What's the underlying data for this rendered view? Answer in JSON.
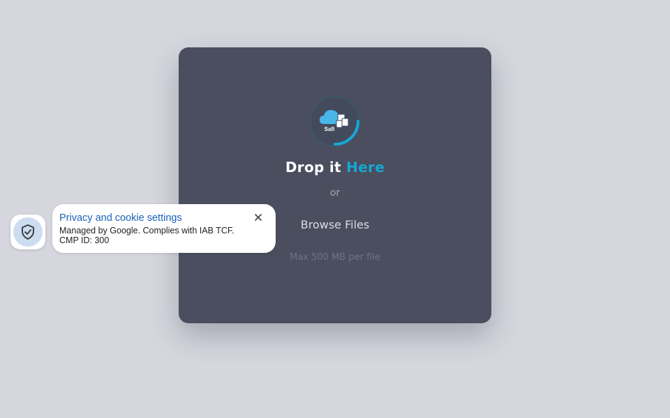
{
  "upload": {
    "logo_text": "Safi",
    "title_prefix": "Drop it ",
    "title_accent": "Here",
    "or_text": "or",
    "browse_label": "Browse Files",
    "max_size": "Max 500 MB per file"
  },
  "privacy": {
    "title": "Privacy and cookie settings",
    "line1": "Managed by Google. Complies with IAB TCF.",
    "line2": "CMP ID: 300"
  },
  "colors": {
    "background": "#d6d6de",
    "card": "#4a4e5e",
    "accent": "#16a6d4",
    "privacy_link": "#1a62b8"
  },
  "icons": {
    "logo": "cloud-upload-logo-icon",
    "shield": "shield-check-icon",
    "close": "close-icon"
  }
}
